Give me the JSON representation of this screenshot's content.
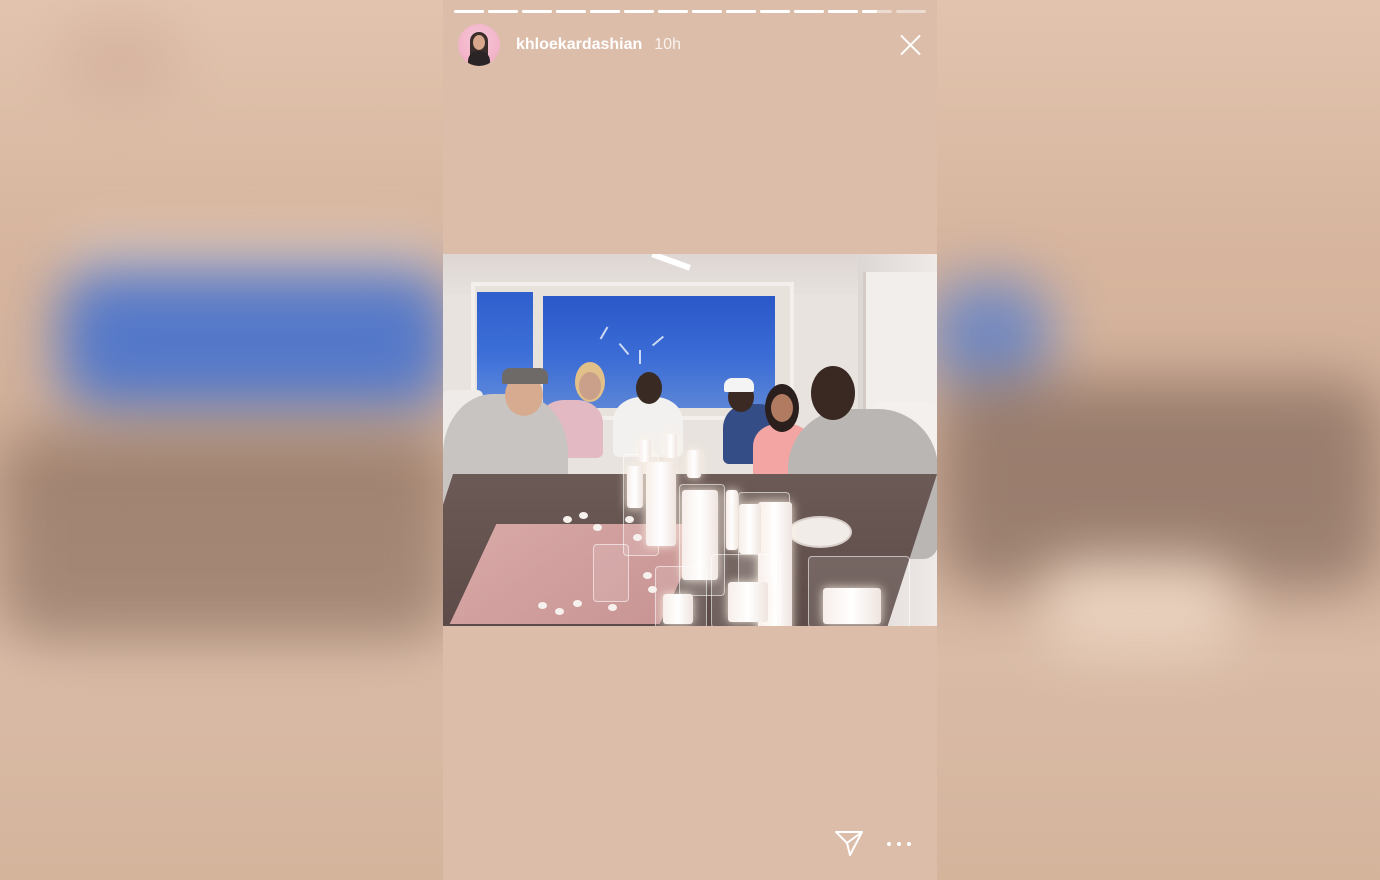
{
  "story": {
    "username": "khloekardashian",
    "time_ago": "10h",
    "progress": {
      "segment_count": 14,
      "completed_segments": 12,
      "current_segment_fill": 0.5
    }
  },
  "photo": {
    "description_icon": "dinner-party-photo"
  },
  "footer": {
    "send_icon": "paper-plane-icon",
    "more_icon": "ellipsis-icon"
  },
  "colors": {
    "background": "#d8b9a2",
    "text": "#ffffff"
  }
}
